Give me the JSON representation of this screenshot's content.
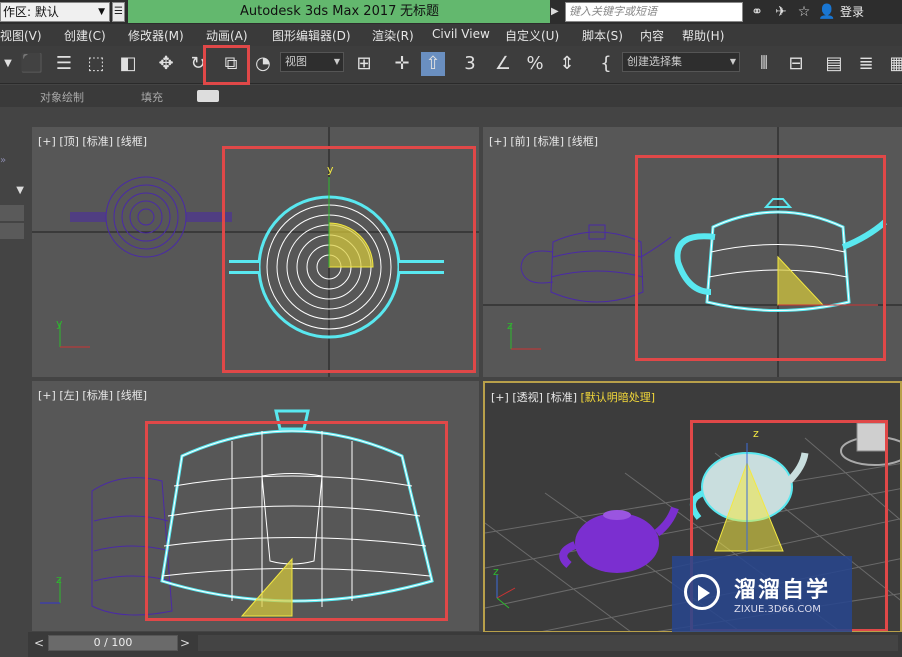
{
  "titlebar": {
    "workspace": "作区: 默认",
    "app_title": "Autodesk 3ds Max 2017",
    "doc_title": "无标题",
    "search_placeholder": "键入关键字或短语",
    "login": "登录"
  },
  "menu": [
    "视图(V)",
    "创建(C)",
    "修改器(M)",
    "动画(A)",
    "图形编辑器(D)",
    "渲染(R)",
    "Civil View",
    "自定义(U)",
    "脚本(S)",
    "内容",
    "帮助(H)"
  ],
  "toolbar": {
    "view_dropdown": "视图",
    "selection_set": "创建选择集"
  },
  "ribbon": {
    "object_paint": "对象绘制",
    "fill": "填充"
  },
  "viewports": {
    "top": [
      "[+]",
      "[顶]",
      "[标准]",
      "[线框]"
    ],
    "front": [
      "[+]",
      "[前]",
      "[标准]",
      "[线框]"
    ],
    "left": [
      "[+]",
      "[左]",
      "[标准]",
      "[线框]"
    ],
    "persp": [
      "[+]",
      "[透视]",
      "[标准]",
      "[默认明暗处理]"
    ]
  },
  "axis_labels": {
    "y": "y",
    "z": "z"
  },
  "timeline": {
    "frame": "0 / 100",
    "prev": "<",
    "next": ">"
  },
  "watermark": {
    "cn": "溜溜自学",
    "en": "ZIXUE.3D66.COM"
  },
  "colors": {
    "highlight": "#e04848",
    "title_green": "#63b86e",
    "selected_wire": "#ffffff",
    "selection_outline": "#59e8f0",
    "unselected_wire": "#4a2aa6",
    "shaded_unselected": "#7b2fd0",
    "gizmo_yellow": "#f3e842"
  }
}
